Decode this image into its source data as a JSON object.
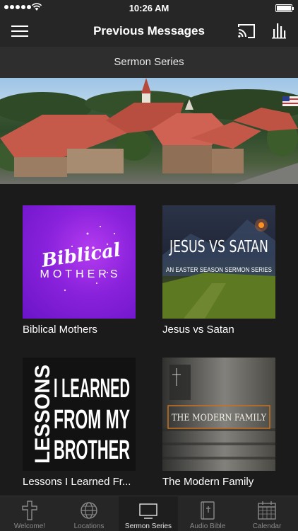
{
  "status": {
    "time": "10:26 AM"
  },
  "nav": {
    "title": "Previous Messages"
  },
  "section": {
    "title": "Sermon Series"
  },
  "series": [
    {
      "label": "Biblical Mothers",
      "art_line1": "Biblical",
      "art_line2": "MOTHERS"
    },
    {
      "label": "Jesus vs Satan",
      "art_line1": "JESUS VS SATAN",
      "art_line2": "AN EASTER SEASON SERMON SERIES"
    },
    {
      "label": "Lessons I Learned Fr...",
      "art_side": "LESSONS",
      "art_line1": "I LEARNED",
      "art_line2": "FROM MY",
      "art_line3": "BROTHER"
    },
    {
      "label": "The Modern Family",
      "art_line1": "THE MODERN FAMILY"
    }
  ],
  "tabs": [
    {
      "label": "Welcome!",
      "icon": "cross-icon"
    },
    {
      "label": "Locations",
      "icon": "globe-icon"
    },
    {
      "label": "Sermon Series",
      "icon": "tv-icon",
      "active": true
    },
    {
      "label": "Audio Bible",
      "icon": "bible-icon"
    },
    {
      "label": "Calendar",
      "icon": "calendar-icon"
    }
  ],
  "colors": {
    "bar": "#262626",
    "background": "#1b1b1b",
    "tab_inactive": "#8a8a8a"
  }
}
